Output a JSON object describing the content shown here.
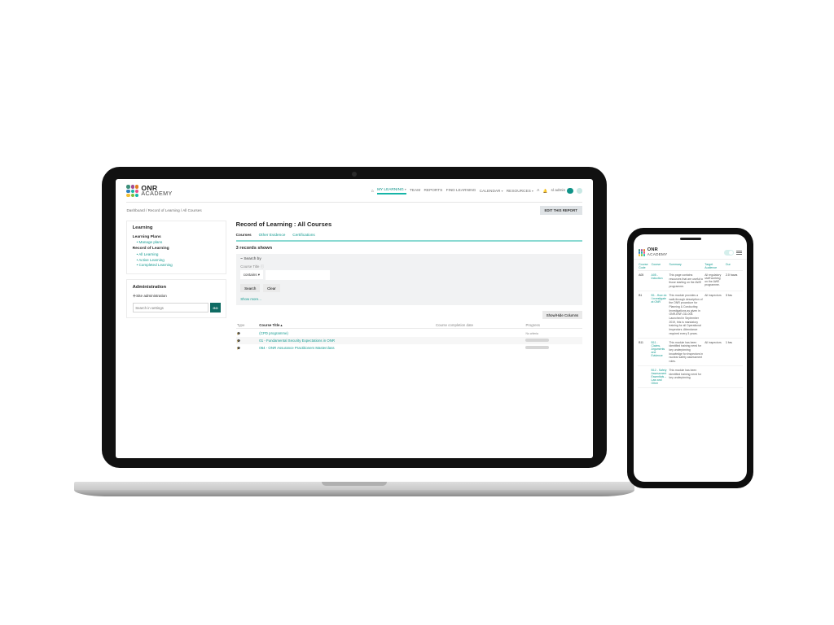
{
  "brand": {
    "line1": "ONR",
    "line2": "ACADEMY"
  },
  "nav": {
    "items": [
      "MY LEARNING",
      "TEAM",
      "REPORTS",
      "FIND LEARNING",
      "CALENDAR",
      "RESOURCES",
      "A"
    ],
    "active_index": 0,
    "user_label": "sl admin"
  },
  "breadcrumbs": [
    "Dashboard",
    "Record of Learning",
    "All Courses"
  ],
  "edit_report_label": "EDIT THIS REPORT",
  "sidebar": {
    "learning_title": "Learning",
    "plans_title": "Learning Plans",
    "plans_items": [
      "Manage plans"
    ],
    "rol_title": "Record of Learning",
    "rol_items": [
      "All Learning",
      "Active Learning",
      "Completed Learning"
    ],
    "admin_title": "Administration",
    "admin_expand": "Site administration",
    "search_placeholder": "Search in settings",
    "go_label": "GO"
  },
  "page_title": "Record of Learning : All Courses",
  "tabs": [
    "Courses",
    "Other Evidence",
    "Certifications"
  ],
  "tabs_active": 0,
  "record_count_label": "3 records shown",
  "search_panel": {
    "header": "Search by",
    "field_label": "Course Title",
    "operator": "contains",
    "search_label": "Search",
    "clear_label": "Clear",
    "show_more": "Show more..."
  },
  "toggle_columns_label": "Show/Hide Columns",
  "table": {
    "headers": [
      "Type",
      "Course Title",
      "Course completion date",
      "Progress"
    ],
    "sorted_col": 1,
    "rows": [
      {
        "title": "(CPD programme)",
        "date": "",
        "progress_text": "No criteria"
      },
      {
        "title": "01 - Fundamental Security Expectations in ONR",
        "date": "",
        "progress_text": ""
      },
      {
        "title": "064 - ONR Assurance Practitioners Masterclass",
        "date": "",
        "progress_text": ""
      }
    ]
  },
  "phone": {
    "columns": [
      "Course Code",
      "Course",
      "Summary",
      "Target Audience",
      "Dur"
    ],
    "rows": [
      {
        "code": "A05",
        "course": "A05 - Induction",
        "summary": "This page contains resources that are useful to those starting on the AWE programme.",
        "audience": "All regulatory staff working on the AWE programme.",
        "duration": "2.0 hours"
      },
      {
        "code": "B1",
        "course": "B1 - How do I investigate at ONR",
        "summary": "This module provides a walk-through description of the ONR procedure for Planning & Conducting Investigations as given in ONR-ENF-GD-005. Launched in September 2019, this is mandatory training for all Operational Inspectors. Attendance required every 3 years.",
        "audience": "All inspectors",
        "duration": "3 hrs"
      },
      {
        "code": "B11",
        "course": "B11 - Claims, Arguments and Evidence",
        "summary": "This module has been identified training need for key underpinning knowledge for inspectors in nuclear safety assessment roles.",
        "audience": "All inspectors",
        "duration": "1 hrs"
      },
      {
        "code": "",
        "course": "B12 - Safety Assessment Essentials – Law and Other",
        "summary": "This module has been identified training need for key underpinning",
        "audience": "",
        "duration": ""
      }
    ]
  }
}
